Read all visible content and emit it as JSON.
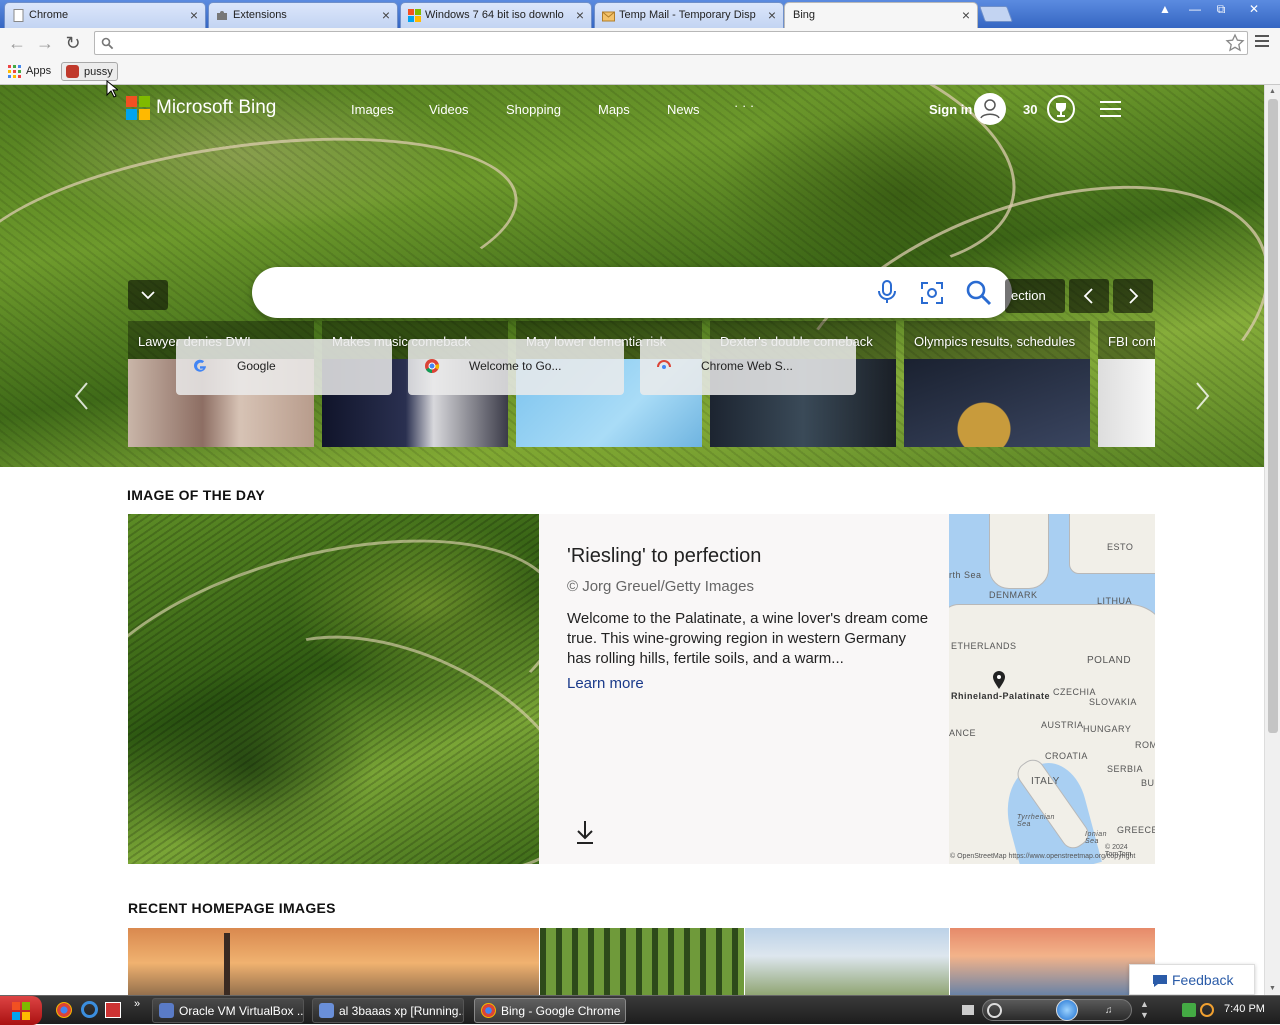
{
  "browser": {
    "tabs": [
      {
        "label": "Chrome",
        "icon": "page-icon"
      },
      {
        "label": "Extensions",
        "icon": "puzzle-icon"
      },
      {
        "label": "Windows 7 64 bit iso downlo",
        "icon": "windows-icon"
      },
      {
        "label": "Temp Mail - Temporary Disp",
        "icon": "mail-icon"
      },
      {
        "label": "Bing",
        "icon": "none",
        "active": true
      }
    ],
    "address": "",
    "bookmarks": [
      {
        "label": "Apps",
        "icon": "apps-grid-icon"
      },
      {
        "label": "pussy",
        "icon": "bookmark-favicon"
      }
    ]
  },
  "bing": {
    "logo": "Microsoft Bing",
    "nav": [
      "Images",
      "Videos",
      "Shopping",
      "Maps",
      "News",
      "· · ·"
    ],
    "sign_in": "Sign in",
    "rewards_points": "30",
    "search_placeholder": "",
    "collection_button": "ection",
    "news_cards": [
      {
        "title": "Lawyer denies DWI"
      },
      {
        "title": "Makes music comeback"
      },
      {
        "title": "May lower dementia risk"
      },
      {
        "title": "Dexter's double comeback"
      },
      {
        "title": "Olympics results, schedules"
      },
      {
        "title": "FBI confi"
      }
    ],
    "quick_links": [
      {
        "label": "Google"
      },
      {
        "label": "Welcome to Go..."
      },
      {
        "label": "Chrome Web S..."
      }
    ],
    "image_of_the_day": {
      "section": "IMAGE OF THE DAY",
      "title": "'Riesling' to perfection",
      "credit": "© Jorg Greuel/Getty Images",
      "description": "Welcome to the Palatinate, a wine lover's dream come true. This wine-growing region in western Germany has rolling hills, fertile soils, and a warm...",
      "learn_more": "Learn more",
      "map": {
        "labels": [
          "DENMARK",
          "POLAND",
          "ETHERLANDS",
          "CZECHIA",
          "SLOVAKIA",
          "AUSTRIA",
          "HUNGARY",
          "CROATIA",
          "SERBIA",
          "ITALY",
          "GREECE",
          "ANCE",
          "LITHUA",
          "ESTO",
          "ROM",
          "BU",
          "rth Sea",
          "Tyrrhenian Sea",
          "Ionian Sea"
        ],
        "pin_label": "Rhineland-Palatinate",
        "copyright": "© 2024 TomTom",
        "attribution": "© OpenStreetMap https://www.openstreetmap.org/copyright"
      }
    },
    "recent_section": "RECENT HOMEPAGE IMAGES",
    "feedback": "Feedback"
  },
  "taskbar": {
    "items": [
      {
        "label": "Oracle VM VirtualBox ..."
      },
      {
        "label": "al 3baaas xp [Running..."
      },
      {
        "label": "Bing - Google Chrome"
      }
    ],
    "clock": "7:40 PM"
  },
  "colors": {
    "chrome_frame": "#3566c2",
    "bing_link": "#1a3a8a",
    "taskbar": "#1d1d1d"
  }
}
